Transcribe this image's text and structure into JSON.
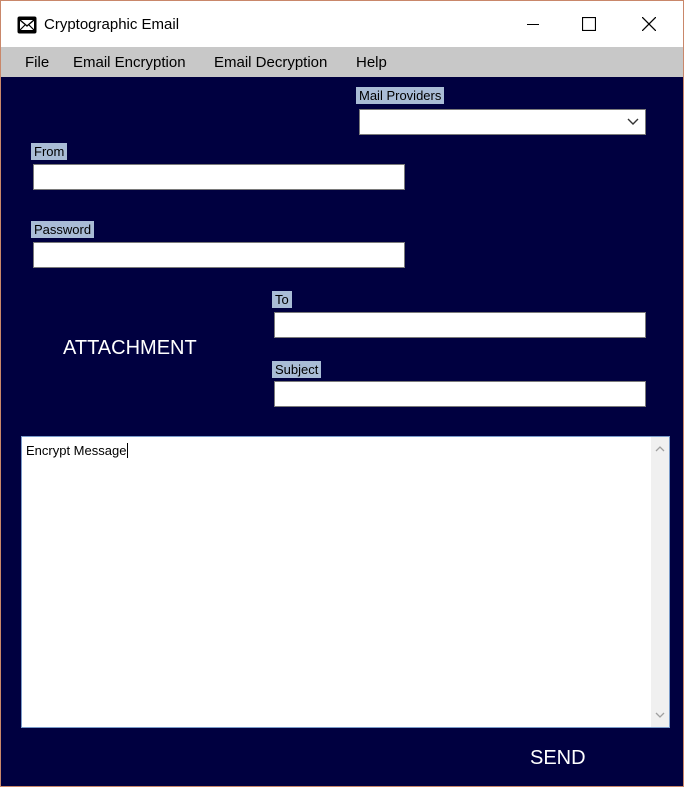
{
  "window": {
    "title": "Cryptographic Email",
    "icon": "envelope-icon"
  },
  "menu": {
    "items": [
      {
        "label": "File"
      },
      {
        "label": "Email Encryption"
      },
      {
        "label": "Email Decryption"
      },
      {
        "label": "Help"
      }
    ]
  },
  "form": {
    "mail_providers_label": "Mail Providers",
    "mail_providers_value": "",
    "from_label": "From",
    "from_value": "",
    "password_label": "Password",
    "password_value": "",
    "to_label": "To",
    "to_value": "",
    "subject_label": "Subject",
    "subject_value": "",
    "attachment_label": "ATTACHMENT",
    "message_text": "Encrypt Message",
    "send_label": "SEND"
  },
  "colors": {
    "background": "#000040",
    "menubar": "#c8c8c8",
    "label_tag": "#a9bcd6",
    "text_light": "#ffffff"
  }
}
